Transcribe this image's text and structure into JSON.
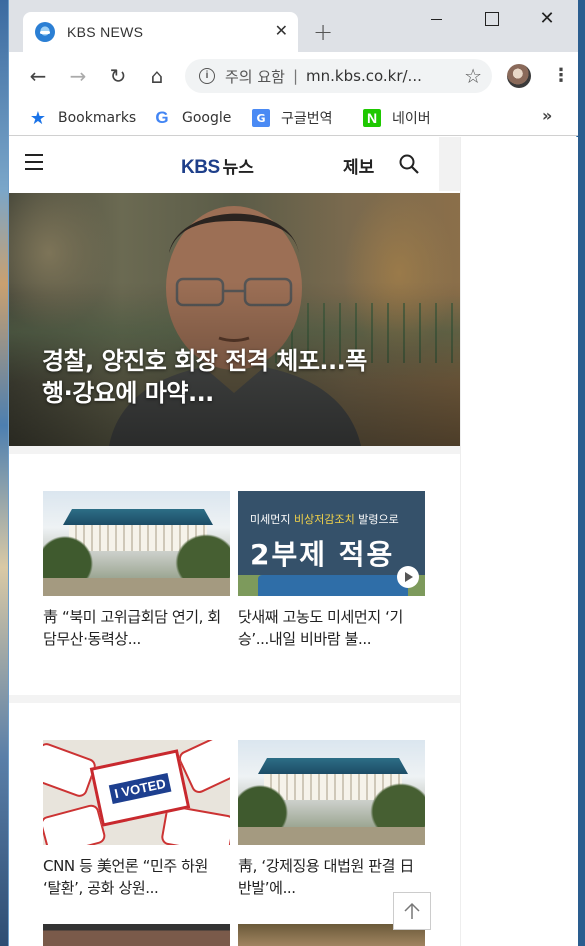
{
  "browser": {
    "tab_title": "KBS NEWS",
    "tab_close": "✕",
    "new_tab": "+",
    "window_controls": {
      "close": "✕"
    },
    "nav": {
      "back": "←",
      "forward": "→",
      "reload": "↻",
      "home": "⌂"
    },
    "omnibox": {
      "security_icon": "i",
      "warning": "주의 요함",
      "separator": "|",
      "url": "mn.kbs.co.kr/..."
    },
    "star_icon": "☆",
    "menu_icon": "⋮",
    "bookmarks": [
      {
        "label": "Bookmarks",
        "icon": "star-icon"
      },
      {
        "label": "Google",
        "icon": "google-icon",
        "glyph": "G"
      },
      {
        "label": "구글번역",
        "icon": "translate-icon",
        "glyph": "G"
      },
      {
        "label": "네이버",
        "icon": "naver-icon",
        "glyph": "N"
      }
    ],
    "bookmarks_more": "»"
  },
  "site": {
    "logo_kbs": "KBS",
    "logo_news": "뉴스",
    "report_label": "제보"
  },
  "hero": {
    "title": "경찰, 양진호 회장 전격 체포...폭행·강요에 마약..."
  },
  "articles": [
    {
      "title": "靑 “북미 고위급회담 연기, 회담무산·동력상...",
      "thumb": "blue-house"
    },
    {
      "title": "닷새째 고농도 미세먼지 ‘기승’...내일 비바람 불...",
      "thumb": "dust-sign",
      "video": true,
      "sign_line1_a": "미세먼지 ",
      "sign_line1_b": "비상저감조치",
      "sign_line1_c": " 발령으로",
      "sign_line2": "2부제 적용"
    },
    {
      "title": "CNN 등 美언론 “민주 하원 ‘탈환’, 공화 상원...",
      "thumb": "i-voted",
      "sticker_text": "I VOTED"
    },
    {
      "title": "靑, ‘강제징용 대법원 판결 日 반발’에...",
      "thumb": "blue-house"
    }
  ],
  "colors": {
    "kbs_blue": "#1e3f8a",
    "naver_green": "#1ec800",
    "chrome_tabstrip": "#dee1e6"
  }
}
